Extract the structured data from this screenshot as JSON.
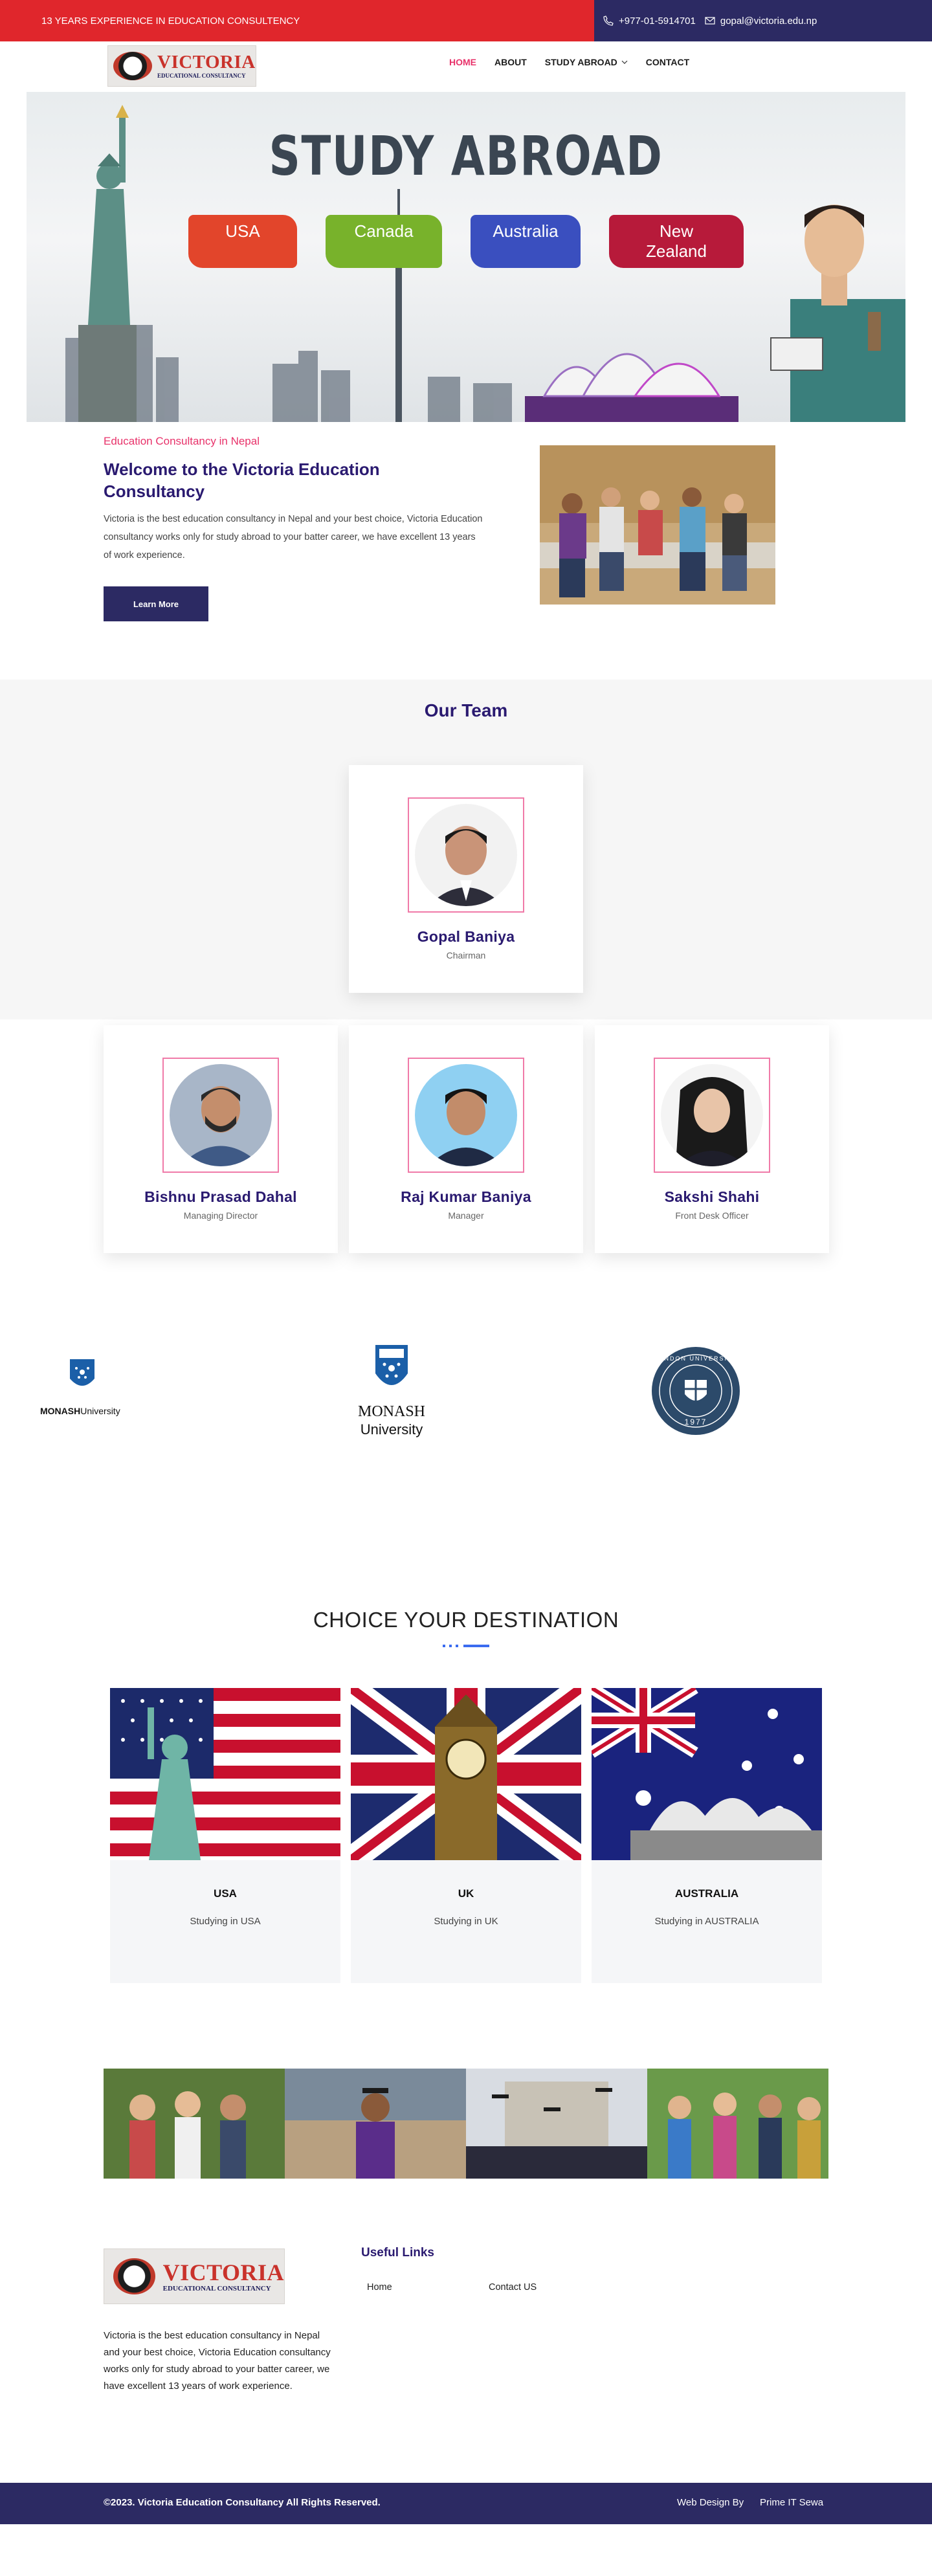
{
  "topbar": {
    "experience": "13 YEARS EXPERIENCE IN EDUCATION CONSULTENCY",
    "phone": "+977-01-5914701",
    "email": "gopal@victoria.edu.np"
  },
  "brand": {
    "name": "VICTORIA",
    "tagline": "EDUCATIONAL CONSULTANCY"
  },
  "nav": {
    "items": [
      "HOME",
      "ABOUT",
      "STUDY ABROAD",
      "CONTACT"
    ],
    "active": "HOME"
  },
  "hero": {
    "title": "STUDY ABROAD",
    "tags": [
      "USA",
      "Canada",
      "Australia",
      "New Zealand"
    ]
  },
  "about": {
    "subtitle": "Education Consultancy in Nepal",
    "title": "Welcome to the Victoria Education Consultancy",
    "text": "Victoria is the best education consultancy in Nepal and your best choice, Victoria Education consultancy works only for study abroad to your batter career, we have excellent 13 years of work experience.",
    "button": "Learn More"
  },
  "team": {
    "title": "Our Team",
    "members": [
      {
        "name": "Gopal Baniya",
        "role": "Chairman"
      },
      {
        "name": "Bishnu Prasad Dahal",
        "role": "Managing Director"
      },
      {
        "name": "Raj Kumar Baniya",
        "role": "Manager"
      },
      {
        "name": "Sakshi Shahi",
        "role": "Front Desk Officer"
      }
    ]
  },
  "partners": {
    "monash_small": {
      "bold": "MONASH",
      "rest": "University"
    },
    "monash_large": {
      "line1": "MONASH",
      "line2": "University"
    },
    "seal": {
      "text": "LONDON UNIVERSITY",
      "year": "1977"
    }
  },
  "destinations": {
    "title": "CHOICE YOUR DESTINATION",
    "items": [
      {
        "name": "USA",
        "desc": "Studying in USA"
      },
      {
        "name": "UK",
        "desc": "Studying in UK"
      },
      {
        "name": "AUSTRALIA",
        "desc": "Studying in AUSTRALIA"
      }
    ]
  },
  "footer": {
    "about": "Victoria is the best education consultancy in Nepal and your best choice, Victoria Education consultancy works only for study abroad to your batter career, we have excellent 13 years of work experience.",
    "links_title": "Useful Links",
    "links": [
      "Home",
      "Contact US"
    ],
    "copyright": "©2023. Victoria Education Consultancy All Rights Reserved.",
    "credit": "Web Design By",
    "credit_link": "Prime IT Sewa"
  },
  "colors": {
    "red": "#e0262c",
    "navy": "#2c2a63",
    "purple_heading": "#2a1a70",
    "pink_accent": "#e8326a",
    "blue_accent": "#3b6cf0"
  }
}
